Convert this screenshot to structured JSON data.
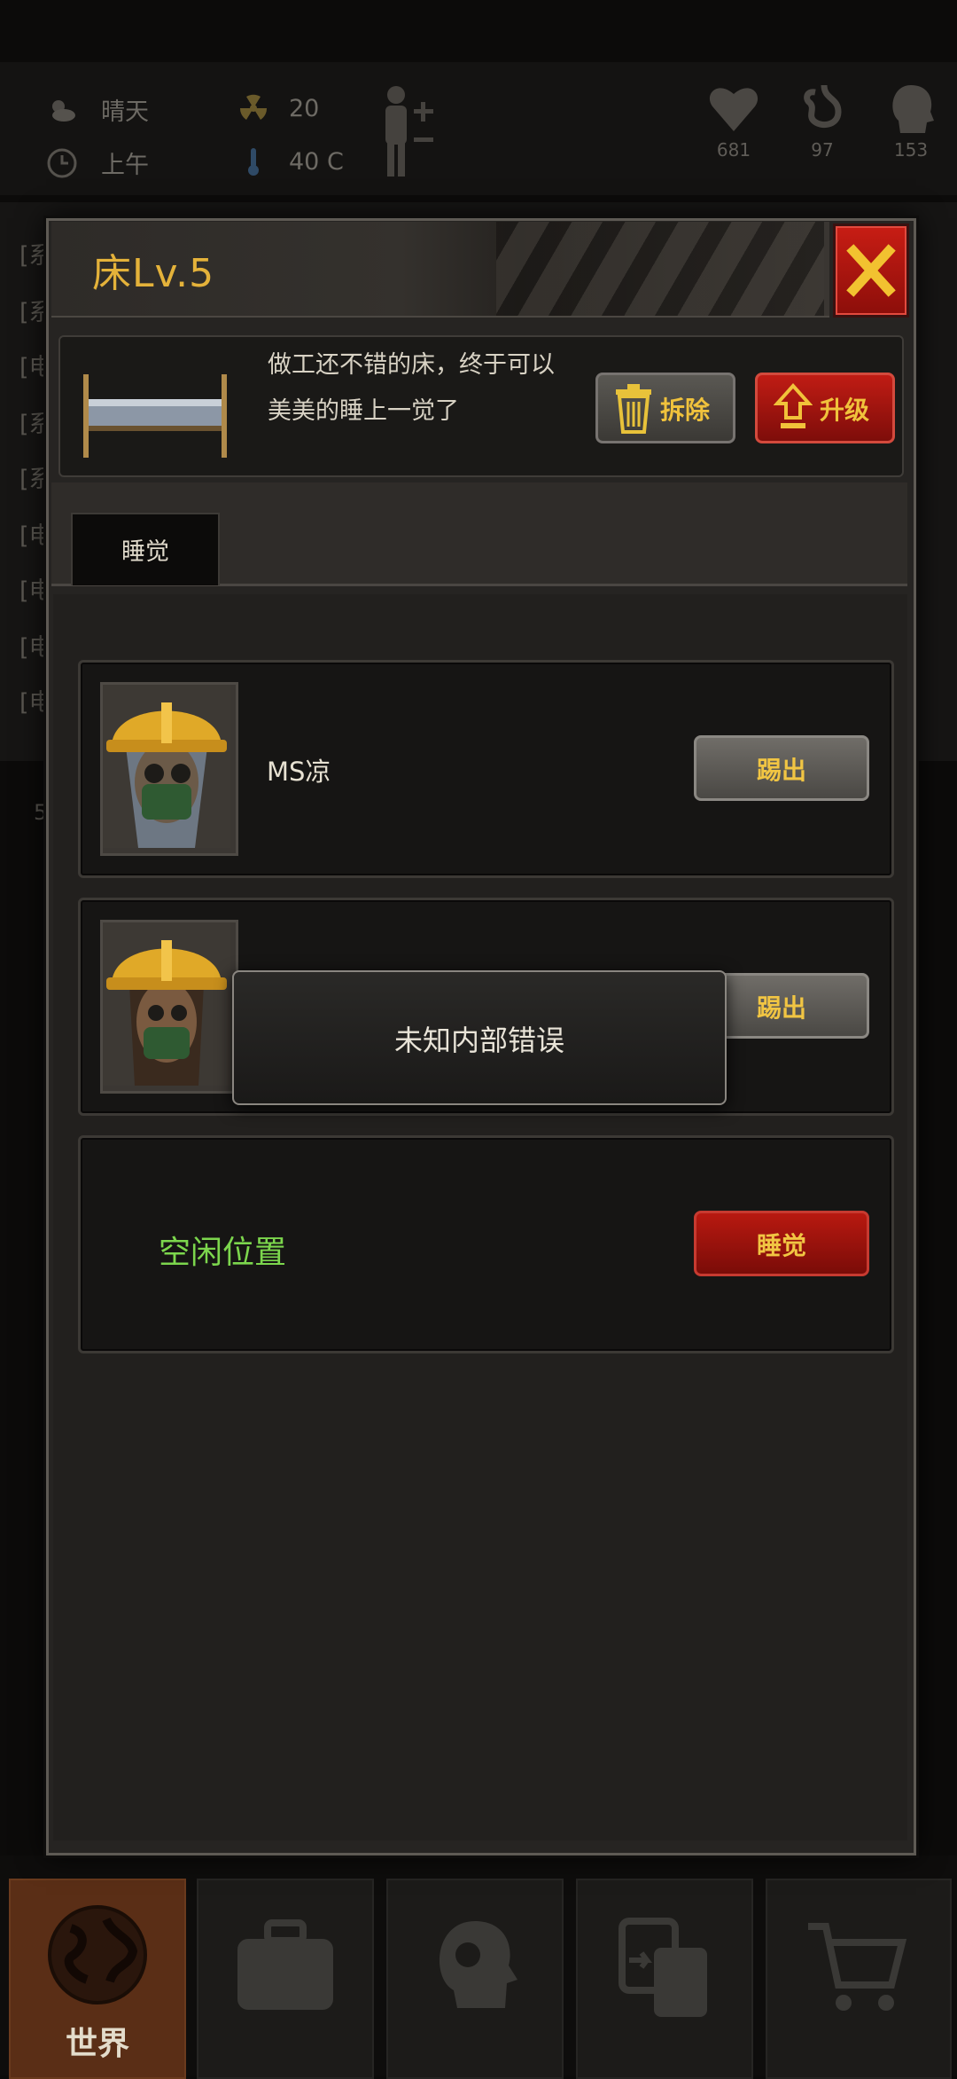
{
  "status_bar": {
    "weather": "晴天",
    "time_of_day": "上午",
    "radiation": "20",
    "temperature": "40 C",
    "health": "681",
    "hunger": "97",
    "mood": "153"
  },
  "background_log": {
    "lines": [
      "[系",
      "[系",
      "[电",
      "[系",
      "[系",
      "[电",
      "[电",
      "[电",
      "[电"
    ],
    "side_number": "5"
  },
  "dialog": {
    "title": "床Lv.5",
    "description": "做工还不错的床，终于可以美美的睡上一觉了",
    "dismantle_label": "拆除",
    "upgrade_label": "升级",
    "tabs": [
      {
        "label": "睡觉"
      }
    ],
    "slots": [
      {
        "name": "MS凉",
        "action_label": "踢出"
      },
      {
        "name": "",
        "action_label": "踢出"
      }
    ],
    "empty_slot": {
      "label": "空闲位置",
      "action_label": "睡觉"
    }
  },
  "toast": {
    "message": "未知内部错误"
  },
  "bottom_nav": {
    "items": [
      {
        "label": "世界",
        "icon": "globe-icon"
      },
      {
        "label": "",
        "icon": "suitcase-icon"
      },
      {
        "label": "",
        "icon": "head-gear-icon"
      },
      {
        "label": "",
        "icon": "trade-icon"
      },
      {
        "label": "",
        "icon": "cart-icon"
      }
    ]
  },
  "colors": {
    "accent_gold": "#e4b23a",
    "danger_red": "#c01c14",
    "empty_green": "#7cd64d"
  }
}
